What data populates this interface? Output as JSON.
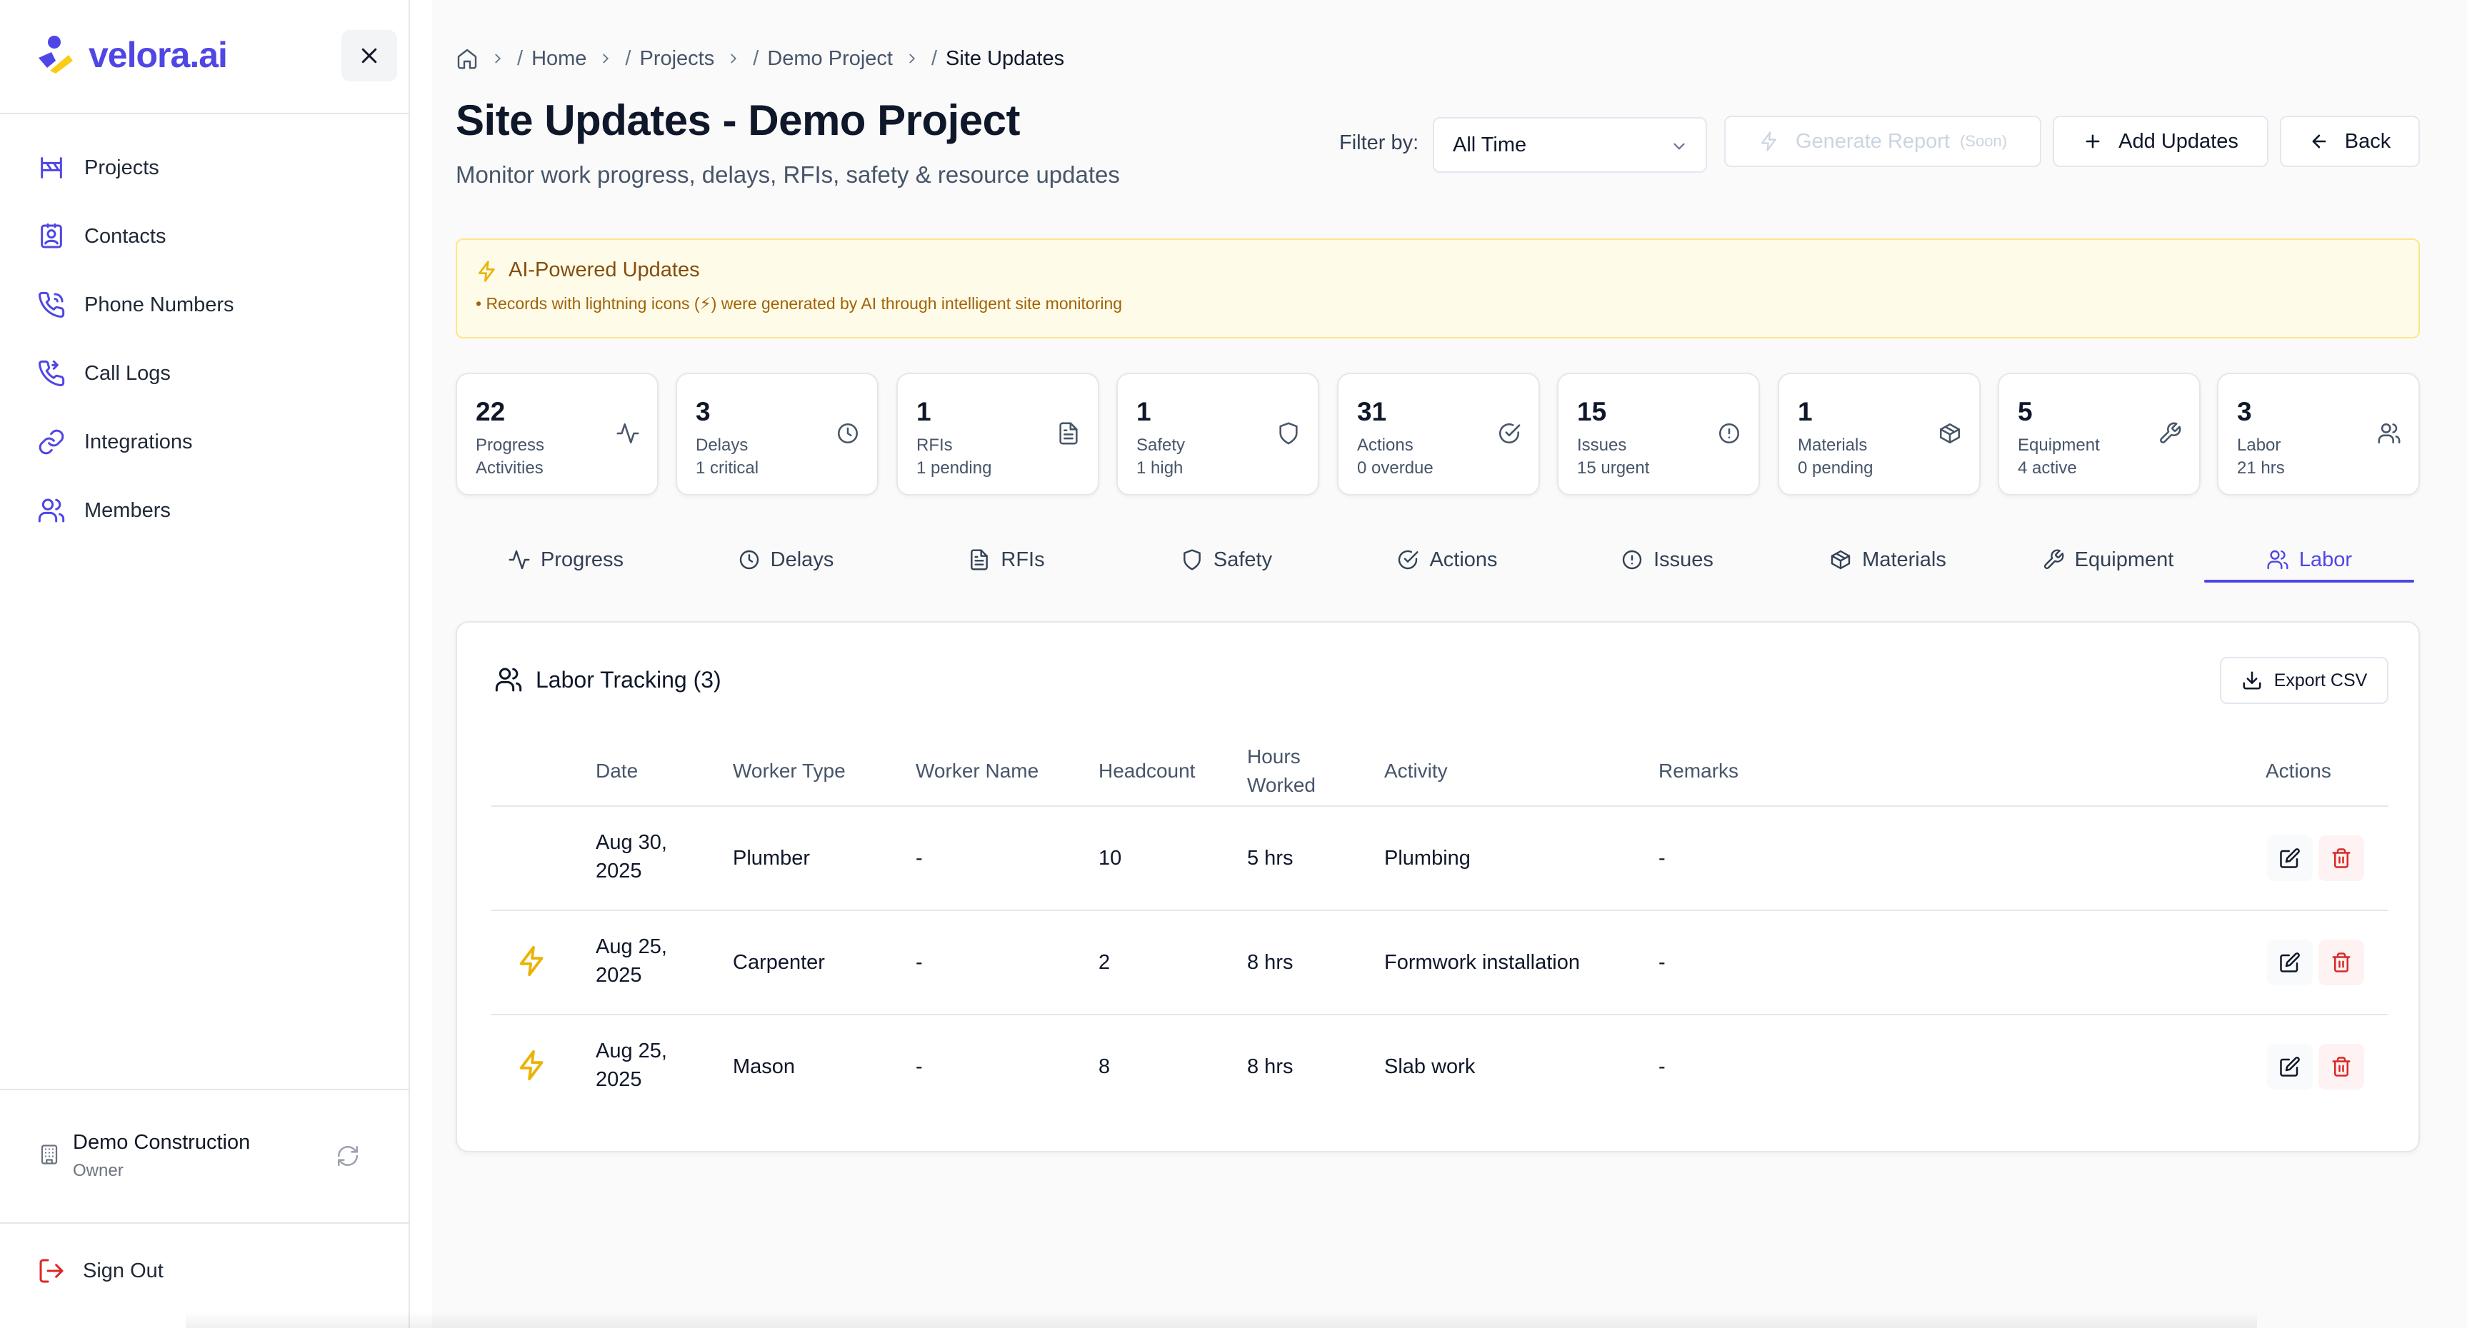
{
  "app": {
    "logo_text": "velora.ai"
  },
  "sidebar": {
    "items": [
      {
        "label": "Projects",
        "icon": "signpost-icon"
      },
      {
        "label": "Contacts",
        "icon": "contact-card-icon"
      },
      {
        "label": "Phone Numbers",
        "icon": "phone-icon"
      },
      {
        "label": "Call Logs",
        "icon": "phone-log-icon"
      },
      {
        "label": "Integrations",
        "icon": "link-icon"
      },
      {
        "label": "Members",
        "icon": "users-icon"
      }
    ],
    "org": {
      "name": "Demo Construction",
      "role": "Owner"
    },
    "sign_out": "Sign Out"
  },
  "breadcrumb": {
    "items": [
      "Home",
      "Projects",
      "Demo Project",
      "Site Updates"
    ]
  },
  "header": {
    "title": "Site Updates - Demo Project",
    "subtitle": "Monitor work progress, delays, RFIs, safety & resource updates",
    "filter_label": "Filter by:",
    "filter_value": "All Time",
    "generate_report": "Generate Report",
    "soon": "(Soon)",
    "add_updates": "Add Updates",
    "back": "Back"
  },
  "ai_banner": {
    "title": "AI-Powered Updates",
    "description": "• Records with lightning icons (⚡) were generated by AI through intelligent site monitoring"
  },
  "stats": [
    {
      "value": "22",
      "label": "Progress",
      "sub": "Activities",
      "icon": "activity-icon"
    },
    {
      "value": "3",
      "label": "Delays",
      "sub": "1 critical",
      "icon": "clock-icon"
    },
    {
      "value": "1",
      "label": "RFIs",
      "sub": "1 pending",
      "icon": "document-icon"
    },
    {
      "value": "1",
      "label": "Safety",
      "sub": "1 high",
      "icon": "shield-icon"
    },
    {
      "value": "31",
      "label": "Actions",
      "sub": "0 overdue",
      "icon": "check-circle-icon"
    },
    {
      "value": "15",
      "label": "Issues",
      "sub": "15 urgent",
      "icon": "alert-circle-icon"
    },
    {
      "value": "1",
      "label": "Materials",
      "sub": "0 pending",
      "icon": "package-icon"
    },
    {
      "value": "5",
      "label": "Equipment",
      "sub": "4 active",
      "icon": "wrench-icon"
    },
    {
      "value": "3",
      "label": "Labor",
      "sub": "21 hrs",
      "icon": "users-icon"
    }
  ],
  "tabs": [
    {
      "label": "Progress",
      "icon": "activity-icon"
    },
    {
      "label": "Delays",
      "icon": "clock-icon"
    },
    {
      "label": "RFIs",
      "icon": "document-icon"
    },
    {
      "label": "Safety",
      "icon": "shield-icon"
    },
    {
      "label": "Actions",
      "icon": "check-circle-icon"
    },
    {
      "label": "Issues",
      "icon": "alert-circle-icon"
    },
    {
      "label": "Materials",
      "icon": "package-icon"
    },
    {
      "label": "Equipment",
      "icon": "wrench-icon"
    },
    {
      "label": "Labor",
      "icon": "users-icon",
      "active": true
    }
  ],
  "labor": {
    "title": "Labor Tracking (3)",
    "export": "Export CSV",
    "columns": {
      "date": "Date",
      "worker_type": "Worker Type",
      "worker_name": "Worker Name",
      "headcount": "Headcount",
      "hours_1": "Hours",
      "hours_2": "Worked",
      "activity": "Activity",
      "remarks": "Remarks",
      "actions": "Actions"
    },
    "rows": [
      {
        "ai": false,
        "date_1": "Aug 30,",
        "date_2": "2025",
        "worker_type": "Plumber",
        "worker_name": "-",
        "headcount": "10",
        "hours": "5 hrs",
        "activity": "Plumbing",
        "remarks": "-"
      },
      {
        "ai": true,
        "date_1": "Aug 25,",
        "date_2": "2025",
        "worker_type": "Carpenter",
        "worker_name": "-",
        "headcount": "2",
        "hours": "8 hrs",
        "activity": "Formwork installation",
        "remarks": "-"
      },
      {
        "ai": true,
        "date_1": "Aug 25,",
        "date_2": "2025",
        "worker_type": "Mason",
        "worker_name": "-",
        "headcount": "8",
        "hours": "8 hrs",
        "activity": "Slab work",
        "remarks": "-"
      }
    ]
  },
  "colors": {
    "accent": "#4f46e5",
    "ai_bolt": "#eab308",
    "danger": "#dc2626",
    "banner_bg": "#fefce8"
  }
}
